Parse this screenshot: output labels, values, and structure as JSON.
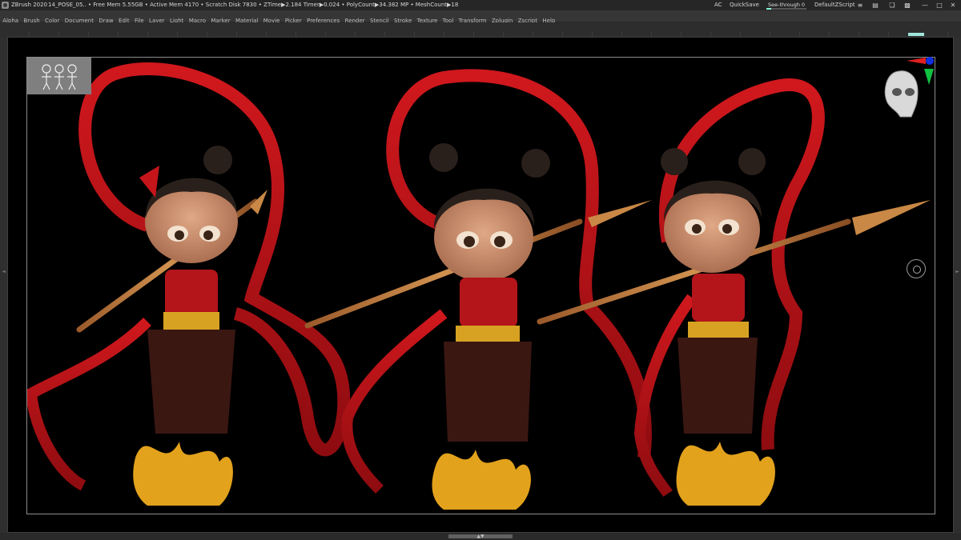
{
  "titlebar": {
    "app": "ZBrush 2020",
    "document": "14_POSE_05",
    "stats": "...  • Free Mem 5.55GB • Active Mem 4170 • Scratch Disk 7830 •  ZTime▶2.184 Timer▶0.024 • PolyCount▶34.382 MP  • MeshCount▶18",
    "ac": "AC",
    "quicksave": "QuickSave",
    "see_through_label": "See-through",
    "see_through_value": "0",
    "see_through_level": 0,
    "default_script": "DefaultZScript"
  },
  "menu": [
    "Alpha",
    "Brush",
    "Color",
    "Document",
    "Draw",
    "Edit",
    "File",
    "Layer",
    "Light",
    "Macro",
    "Marker",
    "Material",
    "Movie",
    "Picker",
    "Preferences",
    "Render",
    "Stencil",
    "Stroke",
    "Texture",
    "Tool",
    "Transform",
    "Zplugin",
    "Zscript",
    "Help"
  ],
  "colors": {
    "ribbon": "#c4151a",
    "ribbon_dark": "#7a0a0c",
    "skin": "#c98f6c",
    "hair": "#2a201b",
    "spear": "#b9753f",
    "sash": "#d7a222",
    "pants": "#3b1712",
    "flame": "#e3a21c"
  },
  "icons": {
    "thumbnail": "character-thumbnail-icon",
    "gizmo": "skull-navigation-gizmo-icon",
    "floor": "floor-grid-icon"
  }
}
